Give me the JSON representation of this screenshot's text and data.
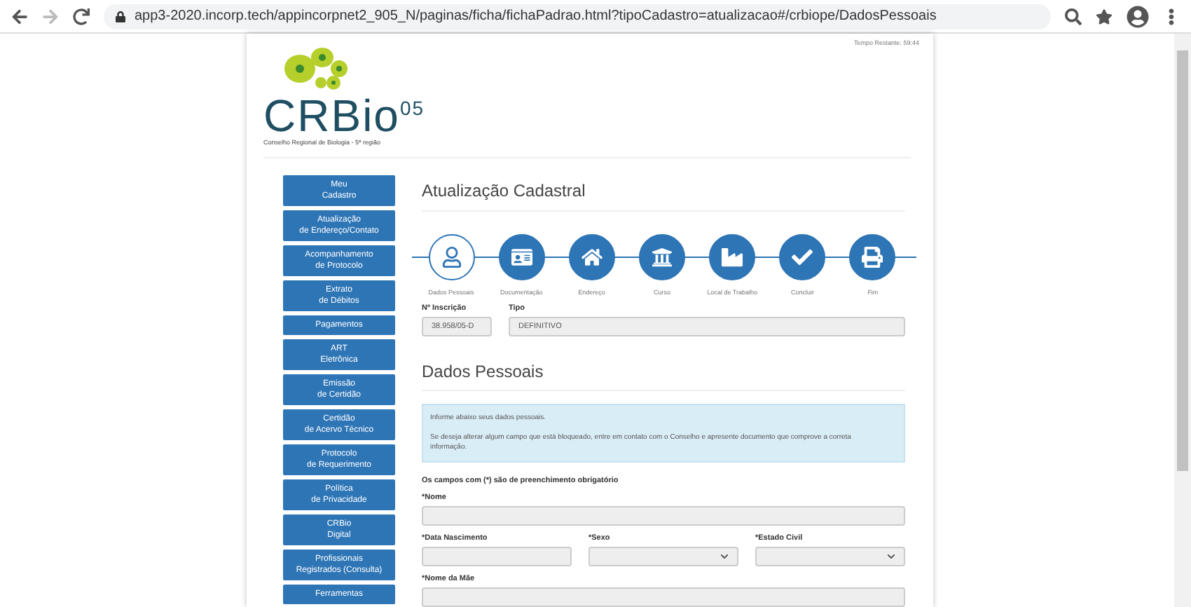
{
  "browser": {
    "url": "app3-2020.incorp.tech/appincorpnet2_905_N/paginas/ficha/fichaPadrao.html?tipoCadastro=atualizacao#/crbiope/DadosPessoais"
  },
  "timer": "Tempo Restante: 59:44",
  "logo": {
    "name": "CRBio",
    "superscript": "05",
    "subtitle": "Conselho Regional de Biologia - 5ª região"
  },
  "sidebar": {
    "items": [
      {
        "lines": [
          "Meu",
          "Cadastro"
        ]
      },
      {
        "lines": [
          "Atualização",
          "de Endereço/Contato"
        ]
      },
      {
        "lines": [
          "Acompanhamento",
          "de Protocolo"
        ]
      },
      {
        "lines": [
          "Extrato",
          "de Débitos"
        ]
      },
      {
        "lines": [
          "Pagamentos"
        ]
      },
      {
        "lines": [
          "ART",
          "Eletrônica"
        ]
      },
      {
        "lines": [
          "Emissão",
          "de Certidão"
        ]
      },
      {
        "lines": [
          "Certidão",
          "de Acervo Técnico"
        ]
      },
      {
        "lines": [
          "Protocolo",
          "de Requerimento"
        ]
      },
      {
        "lines": [
          "Política",
          "de Privacidade"
        ]
      },
      {
        "lines": [
          "CRBio",
          "Digital"
        ]
      },
      {
        "lines": [
          "Profissionais",
          "Registrados (Consulta)"
        ]
      },
      {
        "lines": [
          "Ferramentas"
        ]
      }
    ]
  },
  "title": "Atualização Cadastral",
  "steps": [
    {
      "label": "Dados Pessoais",
      "selected": true
    },
    {
      "label": "Documentação",
      "selected": false
    },
    {
      "label": "Endereço",
      "selected": false
    },
    {
      "label": "Curso",
      "selected": false
    },
    {
      "label": "Local de Trabalho",
      "selected": false
    },
    {
      "label": "Concluir",
      "selected": false
    },
    {
      "label": "Fim",
      "selected": false
    }
  ],
  "registration": [
    {
      "label": "Nº Inscrição",
      "value": "38.958/05-D"
    },
    {
      "label": "Tipo",
      "value": "DEFINITIVO"
    }
  ],
  "section_title": "Dados Pessoais",
  "info": [
    "Informe abaixo seus dados pessoais.",
    "Se deseja alterar algum campo que está bloqueado, entre em contato com o Conselho e apresente documento que comprove a correta informação."
  ],
  "required_note": "Os campos com (*) são de preenchimento obrigatório",
  "form_rows": [
    [
      {
        "label": "*Nome",
        "kind": "text"
      }
    ],
    [
      {
        "label": "*Data Nascimento",
        "kind": "text"
      },
      {
        "label": "*Sexo",
        "kind": "select"
      },
      {
        "label": "*Estado Civil",
        "kind": "select"
      }
    ],
    [
      {
        "label": "*Nome da Mãe",
        "kind": "text"
      }
    ]
  ]
}
